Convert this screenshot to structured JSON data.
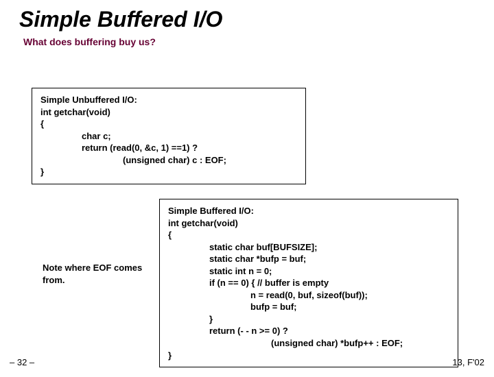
{
  "title": "Simple Buffered I/O",
  "subtitle": "What does buffering buy us?",
  "box1": {
    "label": "Simple Unbuffered I/O:",
    "sig": "int getchar(void)",
    "open": "{",
    "l1": "char c;",
    "l2": "return (read(0, &c, 1) ==1) ?",
    "l3": "(unsigned char) c : EOF;",
    "close": "}"
  },
  "box2": {
    "label": "Simple Buffered I/O:",
    "sig": "int getchar(void)",
    "open": "{",
    "l1": "static char buf[BUFSIZE];",
    "l2": "static char *bufp = buf;",
    "l3": "static int n = 0;",
    "l4": "if (n == 0) {  // buffer is empty",
    "l5": "n = read(0, buf, sizeof(buf));",
    "l6": "bufp = buf;",
    "l7": "}",
    "l8": "return (- - n >= 0) ?",
    "l9": "(unsigned char) *bufp++ : EOF;",
    "close": "}"
  },
  "note": "Note where EOF comes from.",
  "pagenum": "– 32 –",
  "footer_right": "13, F'02"
}
